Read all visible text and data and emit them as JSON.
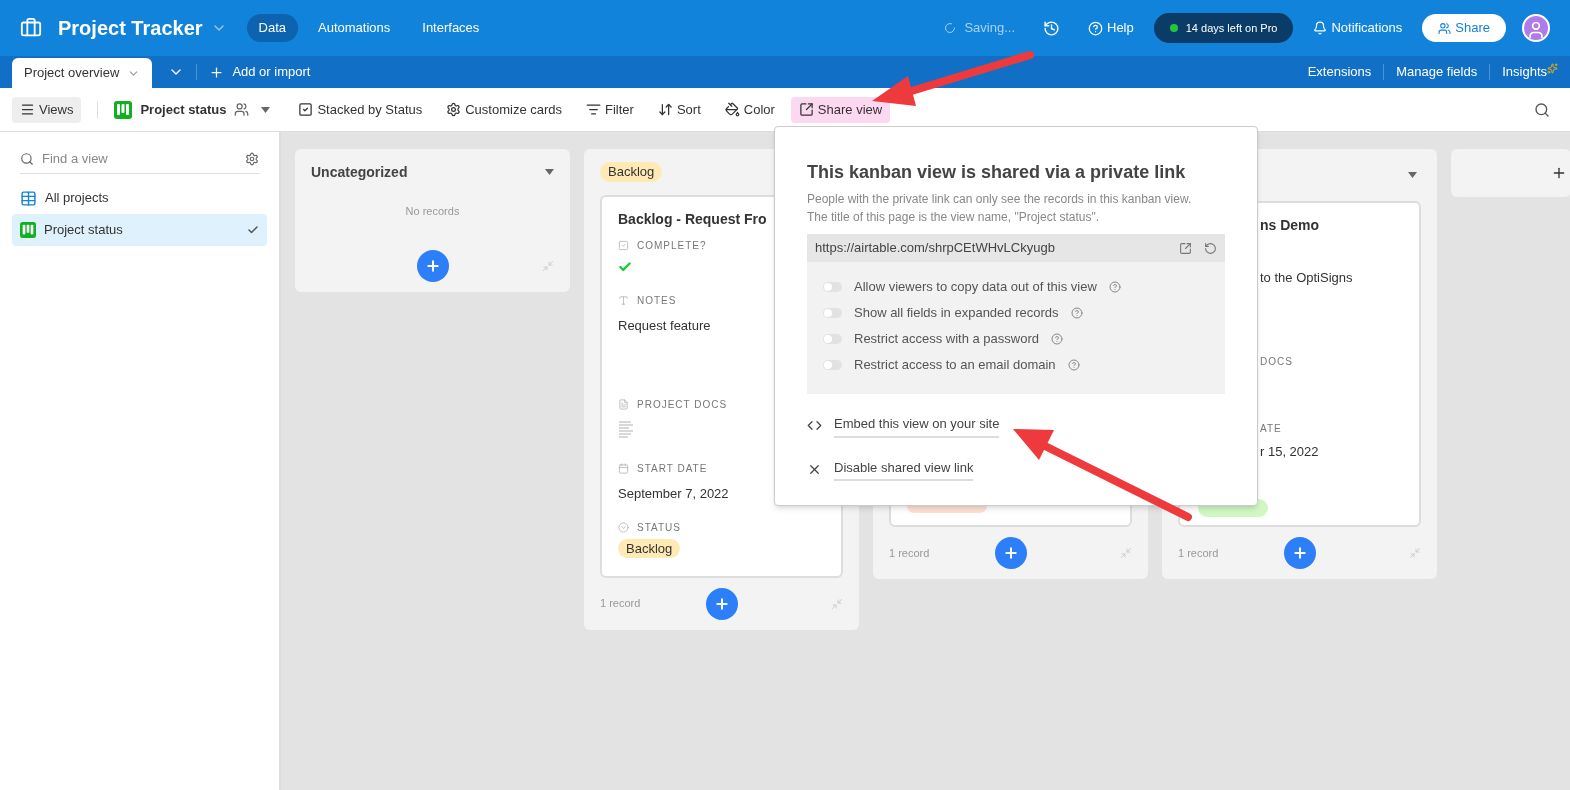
{
  "app": {
    "title": "Project Tracker",
    "nav": [
      {
        "label": "Data",
        "selected": true
      },
      {
        "label": "Automations",
        "selected": false
      },
      {
        "label": "Interfaces",
        "selected": false
      }
    ],
    "status": "Saving...",
    "help": "Help",
    "trial": "14 days left on Pro",
    "notifications": "Notifications",
    "share": "Share"
  },
  "tabbar": {
    "tabs": [
      {
        "label": "Project overview",
        "selected": true
      }
    ],
    "add": "Add or import",
    "links": [
      "Extensions",
      "Manage fields",
      "Insights"
    ]
  },
  "toolbar": {
    "views": "Views",
    "view_name": "Project status",
    "items": [
      {
        "kind": "stack",
        "label": "Stacked by Status",
        "selected": false
      },
      {
        "kind": "customize",
        "label": "Customize cards",
        "selected": false
      },
      {
        "kind": "filter",
        "label": "Filter",
        "selected": false
      },
      {
        "kind": "sort",
        "label": "Sort",
        "selected": false
      },
      {
        "kind": "color",
        "label": "Color",
        "selected": false
      },
      {
        "kind": "share",
        "label": "Share view",
        "selected": true
      }
    ]
  },
  "sidebar": {
    "search": {
      "placeholder": "Find a view"
    },
    "items": [
      {
        "kind": "grid",
        "label": "All projects",
        "selected": false
      },
      {
        "kind": "kanban",
        "label": "Project status",
        "selected": true
      }
    ]
  },
  "columns": [
    {
      "kind": "empty",
      "title": "Uncategorized",
      "empty_text": "No records"
    },
    {
      "kind": "cards",
      "tag": {
        "label": "Backlog",
        "color": "#ffeab6"
      },
      "cards": [
        {
          "title": "Backlog - Request Fro",
          "fields": [
            {
              "kind": "checkbox",
              "label": "COMPLETE?",
              "checked": true
            },
            {
              "kind": "text",
              "label": "NOTES",
              "value": "Request feature"
            },
            {
              "kind": "attachment",
              "label": "PROJECT DOCS"
            },
            {
              "kind": "date",
              "label": "START DATE",
              "value": "September 7, 2022"
            },
            {
              "kind": "status",
              "label": "STATUS",
              "value": "Backlog",
              "color": "#ffeab6"
            }
          ]
        }
      ],
      "count": "1 record"
    },
    {
      "kind": "covered",
      "status_tag": {
        "color": "#fee2d5"
      },
      "count": "1 record"
    },
    {
      "kind": "partial",
      "title": "ns Demo",
      "notes": "to the OptiSigns",
      "docs_label": "DOCS",
      "date_label": "ATE",
      "date": "r 15, 2022",
      "status_tag": {
        "color": "#d1f7c4"
      },
      "count": "1 record"
    },
    {
      "kind": "add"
    }
  ],
  "share_popup": {
    "title": "This kanban view is shared via a private link",
    "description": [
      "People with the private link can only see the records in this kanban view.",
      "The title of this page is the view name, \"Project status\"."
    ],
    "url": "https://airtable.com/shrpCEtWHvLCkyugb",
    "options": [
      {
        "label": "Allow viewers to copy data out of this view",
        "on": false
      },
      {
        "label": "Show all fields in expanded records",
        "on": false
      },
      {
        "label": "Restrict access with a password",
        "on": false
      },
      {
        "label": "Restrict access to an email domain",
        "on": false
      }
    ],
    "actions": [
      {
        "kind": "embed",
        "label": "Embed this view on your site"
      },
      {
        "kind": "disable",
        "label": "Disable shared view link"
      }
    ]
  }
}
